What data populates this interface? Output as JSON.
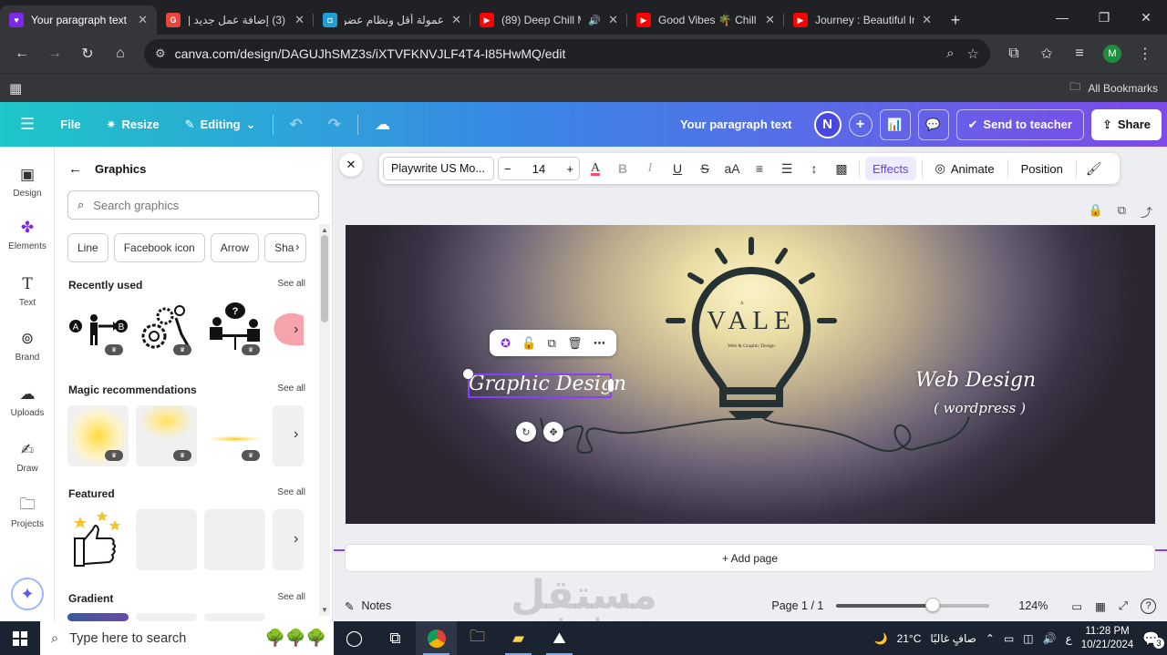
{
  "browser": {
    "tabs": [
      {
        "title": "Your paragraph text -",
        "favicon_color": "#7d2ae8",
        "active": true
      },
      {
        "title": "(3) إضافة عمل جديد |",
        "favicon_color": "#e8453c",
        "active": false
      },
      {
        "title": "عمولة أقل ونظام عضو",
        "favicon_color": "#1ea0d6",
        "active": false
      },
      {
        "title": "(89) Deep Chill M",
        "favicon_color": "#ff0000",
        "active": false
      },
      {
        "title": "Good Vibes 🌴 Chill",
        "favicon_color": "#ff0000",
        "active": false
      },
      {
        "title": "Journey : Beautiful In",
        "favicon_color": "#ff0000",
        "active": false
      }
    ],
    "url": "canva.com/design/DAGUJhSMZ3s/iXTVFKNVJLF4T4-I85HwMQ/edit",
    "profile_initial": "M",
    "all_bookmarks": "All Bookmarks"
  },
  "header": {
    "file": "File",
    "resize": "Resize",
    "editing": "Editing",
    "doc_title": "Your paragraph text",
    "user_initial": "N",
    "send_to_teacher": "Send to teacher",
    "share": "Share"
  },
  "rail": [
    {
      "label": "Design",
      "icon": "design-icon"
    },
    {
      "label": "Elements",
      "icon": "elements-icon"
    },
    {
      "label": "Text",
      "icon": "text-icon"
    },
    {
      "label": "Brand",
      "icon": "brand-icon"
    },
    {
      "label": "Uploads",
      "icon": "uploads-icon"
    },
    {
      "label": "Draw",
      "icon": "draw-icon"
    },
    {
      "label": "Projects",
      "icon": "projects-icon"
    }
  ],
  "panel": {
    "title": "Graphics",
    "search_placeholder": "Search graphics",
    "chips": [
      "Line",
      "Facebook icon",
      "Arrow",
      "Sha"
    ],
    "sections": {
      "recent": {
        "title": "Recently used",
        "see_all": "See all"
      },
      "magic": {
        "title": "Magic recommendations",
        "see_all": "See all"
      },
      "featured": {
        "title": "Featured",
        "see_all": "See all"
      },
      "gradient": {
        "title": "Gradient",
        "see_all": "See all"
      }
    }
  },
  "text_toolbar": {
    "font": "Playwrite US Mo...",
    "size": "14",
    "effects": "Effects",
    "animate": "Animate",
    "position": "Position"
  },
  "canvas": {
    "logo": "VALE",
    "logo_small_letter": "A",
    "logo_tagline": "Web & Graphic Design",
    "left_text": "Graphic Design",
    "right_text": "Web Design",
    "right_subtext": "( wordpress )"
  },
  "add_page": "+ Add page",
  "status": {
    "notes": "Notes",
    "page": "Page 1 / 1",
    "zoom": "124%",
    "zoom_fraction": 0.63
  },
  "taskbar": {
    "search_placeholder": "Type here to search",
    "temperature": "21°C",
    "weather": "صافٍ غالبًا",
    "lang": "ع",
    "time": "11:28 PM",
    "date": "10/21/2024",
    "notifications": "3"
  },
  "watermark": {
    "arabic": "مستقل",
    "latin": "mostaql.com"
  }
}
